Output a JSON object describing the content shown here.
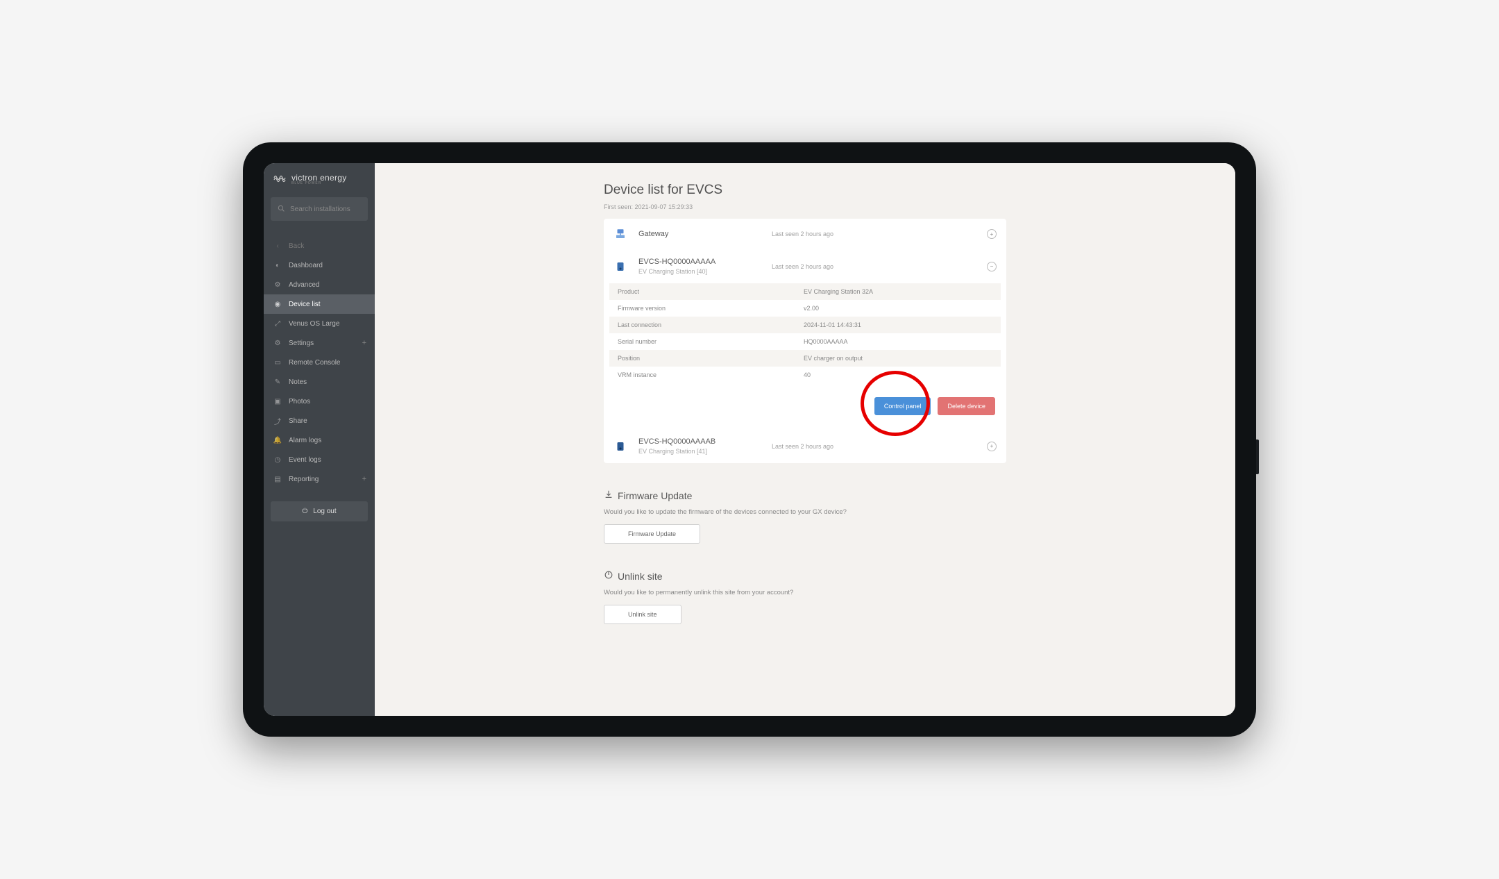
{
  "brand": {
    "name": "victron energy",
    "sub": "BLUE POWER"
  },
  "search": {
    "placeholder": "Search installations"
  },
  "nav": {
    "back": "Back",
    "dashboard": "Dashboard",
    "advanced": "Advanced",
    "deviceList": "Device list",
    "venus": "Venus OS Large",
    "settings": "Settings",
    "remoteConsole": "Remote Console",
    "notes": "Notes",
    "photos": "Photos",
    "share": "Share",
    "alarmLogs": "Alarm logs",
    "eventLogs": "Event logs",
    "reporting": "Reporting",
    "logout": "Log out"
  },
  "page": {
    "title": "Device list for EVCS",
    "firstSeenLabel": "First seen: 2021-09-07 15:29:33"
  },
  "devices": [
    {
      "name": "Gateway",
      "sub": "",
      "seen": "Last seen 2 hours ago"
    },
    {
      "name": "EVCS-HQ0000AAAAA",
      "sub": "EV Charging Station [40]",
      "seen": "Last seen 2 hours ago",
      "details": [
        {
          "label": "Product",
          "value": "EV Charging Station 32A"
        },
        {
          "label": "Firmware version",
          "value": "v2.00"
        },
        {
          "label": "Last connection",
          "value": "2024-11-01 14:43:31"
        },
        {
          "label": "Serial number",
          "value": "HQ0000AAAAA"
        },
        {
          "label": "Position",
          "value": "EV charger on output"
        },
        {
          "label": "VRM instance",
          "value": "40"
        }
      ],
      "controlPanel": "Control panel",
      "deleteDevice": "Delete device"
    },
    {
      "name": "EVCS-HQ0000AAAAB",
      "sub": "EV Charging Station [41]",
      "seen": "Last seen 2 hours ago"
    }
  ],
  "firmware": {
    "title": "Firmware Update",
    "desc": "Would you like to update the firmware of the devices connected to your GX device?",
    "button": "Firmware Update"
  },
  "unlink": {
    "title": "Unlink site",
    "desc": "Would you like to permanently unlink this site from your account?",
    "button": "Unlink site"
  }
}
